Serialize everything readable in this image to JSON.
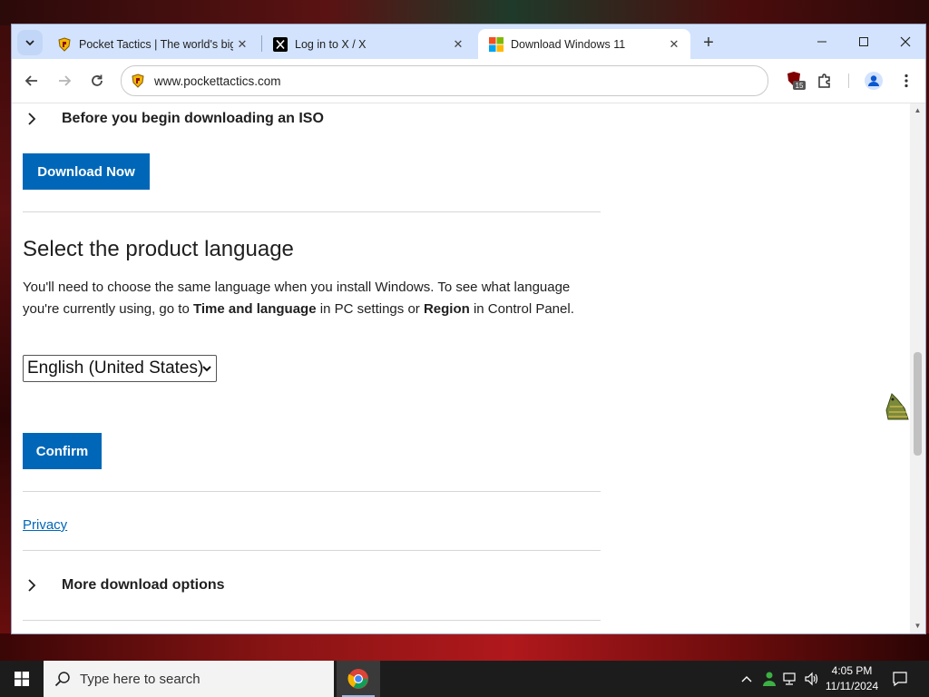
{
  "browser": {
    "tabs": [
      {
        "title": "Pocket Tactics | The world's big",
        "active": false
      },
      {
        "title": "Log in to X / X",
        "active": false
      },
      {
        "title": "Download Windows 11",
        "active": true
      }
    ],
    "url": "www.pockettactics.com",
    "extension_badge": "15"
  },
  "page": {
    "expander_top": "Before you begin downloading an ISO",
    "download_button": "Download Now",
    "heading": "Select the product language",
    "para_1": "You'll need to choose the same language when you install Windows. To see what language you're currently using, go to ",
    "para_bold_1": "Time and language",
    "para_2": " in PC settings or ",
    "para_bold_2": "Region",
    "para_3": " in Control Panel.",
    "language_selected": "English (United States)",
    "confirm_button": "Confirm",
    "privacy_link": "Privacy",
    "expander_bottom": "More download options"
  },
  "taskbar": {
    "search_placeholder": "Type here to search",
    "time": "4:05 PM",
    "date": "11/11/2024"
  },
  "colors": {
    "accent": "#0067b8",
    "tabstrip": "#d3e3fd",
    "taskbar": "#1c1c1c"
  }
}
